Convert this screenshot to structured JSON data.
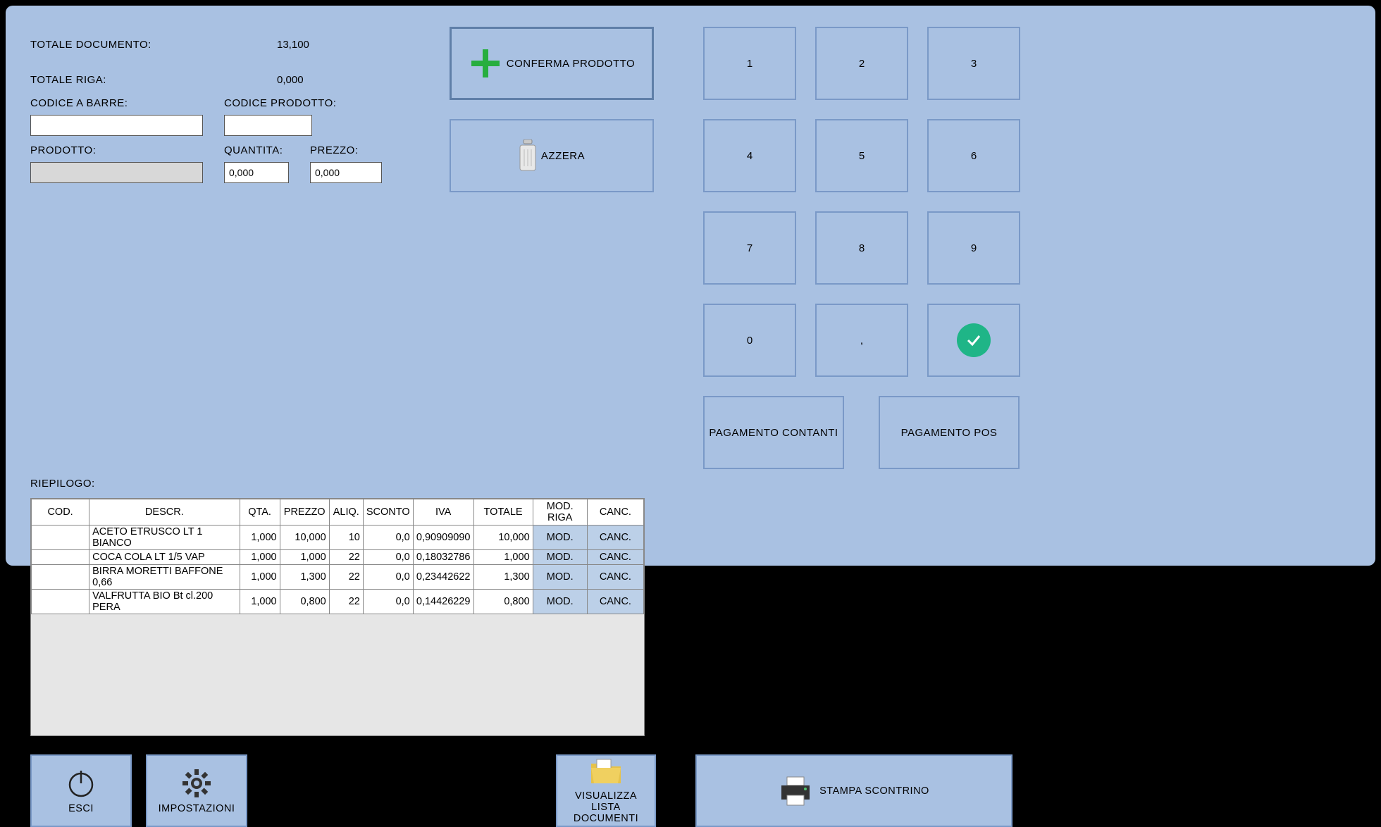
{
  "totals": {
    "doc_label": "TOTALE DOCUMENTO:",
    "doc_value": "13,100",
    "row_label": "TOTALE RIGA:",
    "row_value": "0,000"
  },
  "fields": {
    "barcode_label": "CODICE A BARRE:",
    "barcode_value": "",
    "prodcode_label": "CODICE PRODOTTO:",
    "prodcode_value": "",
    "product_label": "PRODOTTO:",
    "product_value": "",
    "qty_label": "QUANTITA:",
    "qty_value": "0,000",
    "price_label": "PREZZO:",
    "price_value": "0,000"
  },
  "buttons": {
    "confirm": "CONFERMA PRODOTTO",
    "reset": "AZZERA",
    "pay_cash": "PAGAMENTO CONTANTI",
    "pay_pos": "PAGAMENTO POS",
    "exit": "ESCI",
    "settings": "IMPOSTAZIONI",
    "doclist": "VISUALIZZA LISTA DOCUMENTI",
    "print": "STAMPA SCONTRINO"
  },
  "keypad": [
    "1",
    "2",
    "3",
    "4",
    "5",
    "6",
    "7",
    "8",
    "9",
    "0",
    ","
  ],
  "summary": {
    "label": "RIEPILOGO:",
    "headers": [
      "COD.",
      "DESCR.",
      "QTA.",
      "PREZZO",
      "ALIQ.",
      "SCONTO",
      "IVA",
      "TOTALE",
      "MOD. RIGA",
      "CANC."
    ],
    "rows": [
      {
        "cod": "",
        "descr": "ACETO ETRUSCO LT 1 BIANCO",
        "qta": "1,000",
        "prezzo": "10,000",
        "aliq": "10",
        "sconto": "0,0",
        "iva": "0,90909090",
        "totale": "10,000",
        "mod": "MOD.",
        "canc": "CANC."
      },
      {
        "cod": "",
        "descr": "COCA COLA LT 1/5 VAP",
        "qta": "1,000",
        "prezzo": "1,000",
        "aliq": "22",
        "sconto": "0,0",
        "iva": "0,18032786",
        "totale": "1,000",
        "mod": "MOD.",
        "canc": "CANC."
      },
      {
        "cod": "",
        "descr": "BIRRA MORETTI BAFFONE 0,66",
        "qta": "1,000",
        "prezzo": "1,300",
        "aliq": "22",
        "sconto": "0,0",
        "iva": "0,23442622",
        "totale": "1,300",
        "mod": "MOD.",
        "canc": "CANC."
      },
      {
        "cod": "",
        "descr": "VALFRUTTA BIO Bt cl.200 PERA",
        "qta": "1,000",
        "prezzo": "0,800",
        "aliq": "22",
        "sconto": "0,0",
        "iva": "0,14426229",
        "totale": "0,800",
        "mod": "MOD.",
        "canc": "CANC."
      }
    ]
  }
}
